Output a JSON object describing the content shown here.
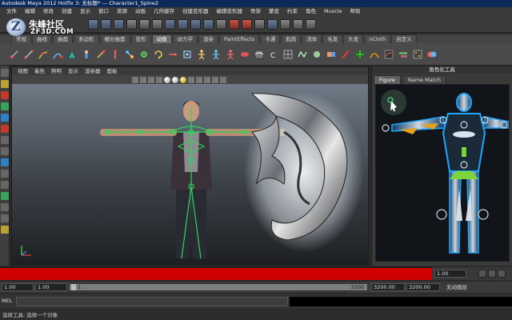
{
  "window": {
    "title": "Autodesk Maya 2012 Hotfix 3: 无标题*   ---   Character1_Spine2"
  },
  "menu": [
    "文件",
    "编辑",
    "修改",
    "创建",
    "显示",
    "窗口",
    "资源",
    "动画",
    "几何缓存",
    "创建变形器",
    "编辑变形器",
    "骨架",
    "蒙皮",
    "约束",
    "角色",
    "Muscle",
    "帮助"
  ],
  "watermark": {
    "name": "朱峰社区",
    "url": "ZF3D.COM"
  },
  "shelf_tabs": [
    "常规",
    "曲线",
    "曲面",
    "多边形",
    "细分曲面",
    "变形",
    "动画",
    "动力学",
    "渲染",
    "PaintEffects",
    "卡通",
    "肌肉",
    "流体",
    "毛发",
    "头发",
    "nCloth",
    "自定义"
  ],
  "shelf_active": "动画",
  "viewport": {
    "menu": [
      "视图",
      "着色",
      "照明",
      "显示",
      "渲染器",
      "面板"
    ]
  },
  "character_panel": {
    "title": "角色化工具",
    "tabs": [
      "Figure",
      "Name Match"
    ],
    "active_tab": "Figure"
  },
  "timeslider": {
    "current": "1.00"
  },
  "range": {
    "start_field": "1.00",
    "start_field2": "1.00",
    "bar_start": "1",
    "bar_end": "3200",
    "end_field": "3200.00",
    "end_field2": "3200.00",
    "anim_layer": "无动画层"
  },
  "command": {
    "label": "MEL"
  },
  "helpline": {
    "text": "选择工具: 选择一个对象"
  },
  "colors": {
    "timeslider": "#d00000",
    "titlebar": "#0b2a5a",
    "skeleton_green": "#2bd65a",
    "figure_blue": "#1ea7ff"
  }
}
